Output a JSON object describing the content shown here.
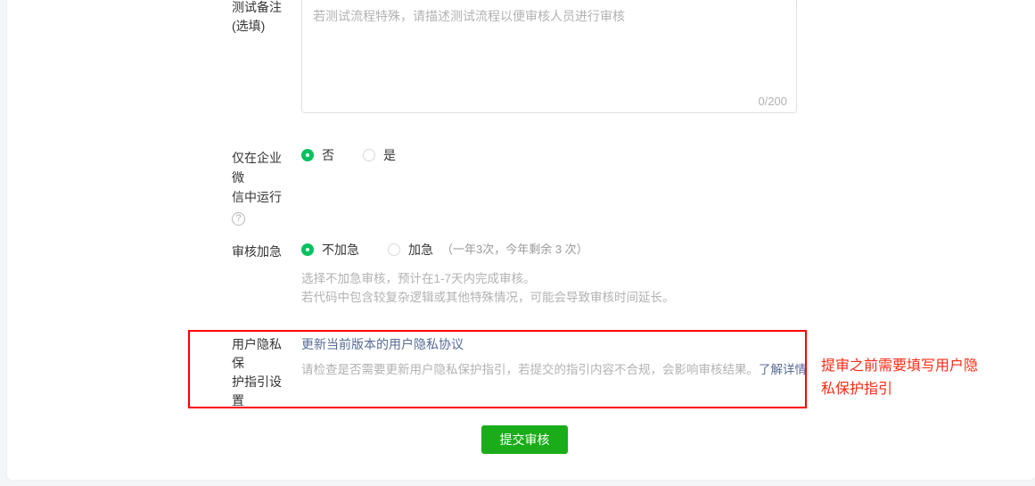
{
  "form": {
    "remark": {
      "label_main": "测试备注",
      "label_sub": "(选填)",
      "placeholder": "若测试流程特殊，请描述测试流程以便审核人员进行审核",
      "value": "",
      "counter": "0/200"
    },
    "wecom_only": {
      "label_line1": "仅在企业微",
      "label_line2": "信中运行",
      "help_icon": "?",
      "options": [
        {
          "label": "否",
          "checked": true
        },
        {
          "label": "是",
          "checked": false
        }
      ]
    },
    "urgent_review": {
      "label": "审核加急",
      "options": [
        {
          "label": "不加急",
          "note": "",
          "checked": true
        },
        {
          "label": "加急",
          "note": "（一年3次，今年剩余 3 次）",
          "checked": false
        }
      ],
      "hint_line1": "选择不加急审核，预计在1-7天内完成审核。",
      "hint_line2": "若代码中包含较复杂逻辑或其他特殊情况，可能会导致审核时间延长。"
    },
    "privacy": {
      "label_line1": "用户隐私保",
      "label_line2": "护指引设置",
      "link_text": "更新当前版本的用户隐私协议",
      "desc_text": "请检查是否需要更新用户隐私保护指引，若提交的指引内容不合规，会影响审核结果。",
      "desc_link": "了解详情"
    }
  },
  "annotation": {
    "text_line1": "提审之前需要填写用户隐",
    "text_line2": "私保护指引",
    "color": "#ff2a15"
  },
  "submit": {
    "label": "提交审核",
    "color": "#1aad19"
  }
}
